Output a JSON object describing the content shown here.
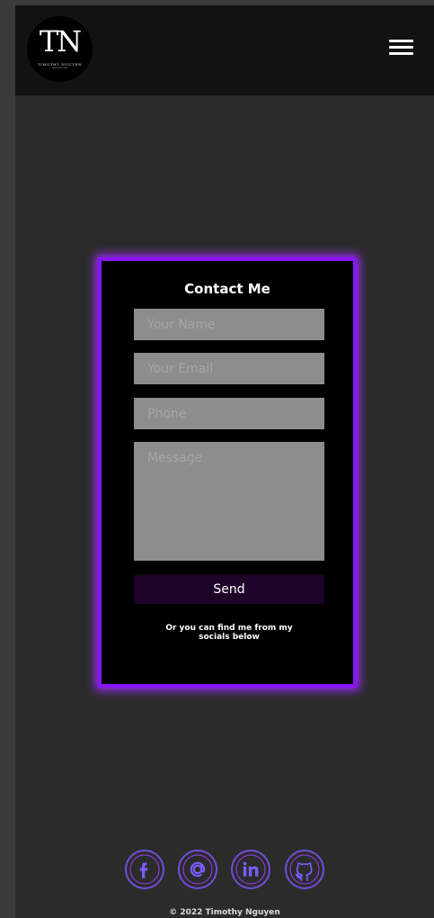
{
  "header": {
    "logo": {
      "monogram": "TN",
      "name": "TIMOTHY NGUYEN",
      "tagline": "WEB DEVELOPER"
    },
    "menu_icon": "hamburger-menu-icon"
  },
  "contact": {
    "title": "Contact Me",
    "name_placeholder": "Your Name",
    "email_placeholder": "Your Email",
    "phone_placeholder": "Phone",
    "message_placeholder": "Message",
    "send_label": "Send",
    "social_note": "Or you can find me from my socials below"
  },
  "socials": [
    {
      "icon": "facebook-icon"
    },
    {
      "icon": "email-at-icon"
    },
    {
      "icon": "linkedin-icon"
    },
    {
      "icon": "github-icon"
    }
  ],
  "footer": {
    "copyright": "© 2022 Timothy Nguyen"
  },
  "colors": {
    "accent_glow": "#8a14ff",
    "page_bg": "#2b2b2b",
    "header_bg": "#121212",
    "card_bg": "#000000",
    "input_bg": "#8d8d8d",
    "button_bg": "#1e0328"
  }
}
